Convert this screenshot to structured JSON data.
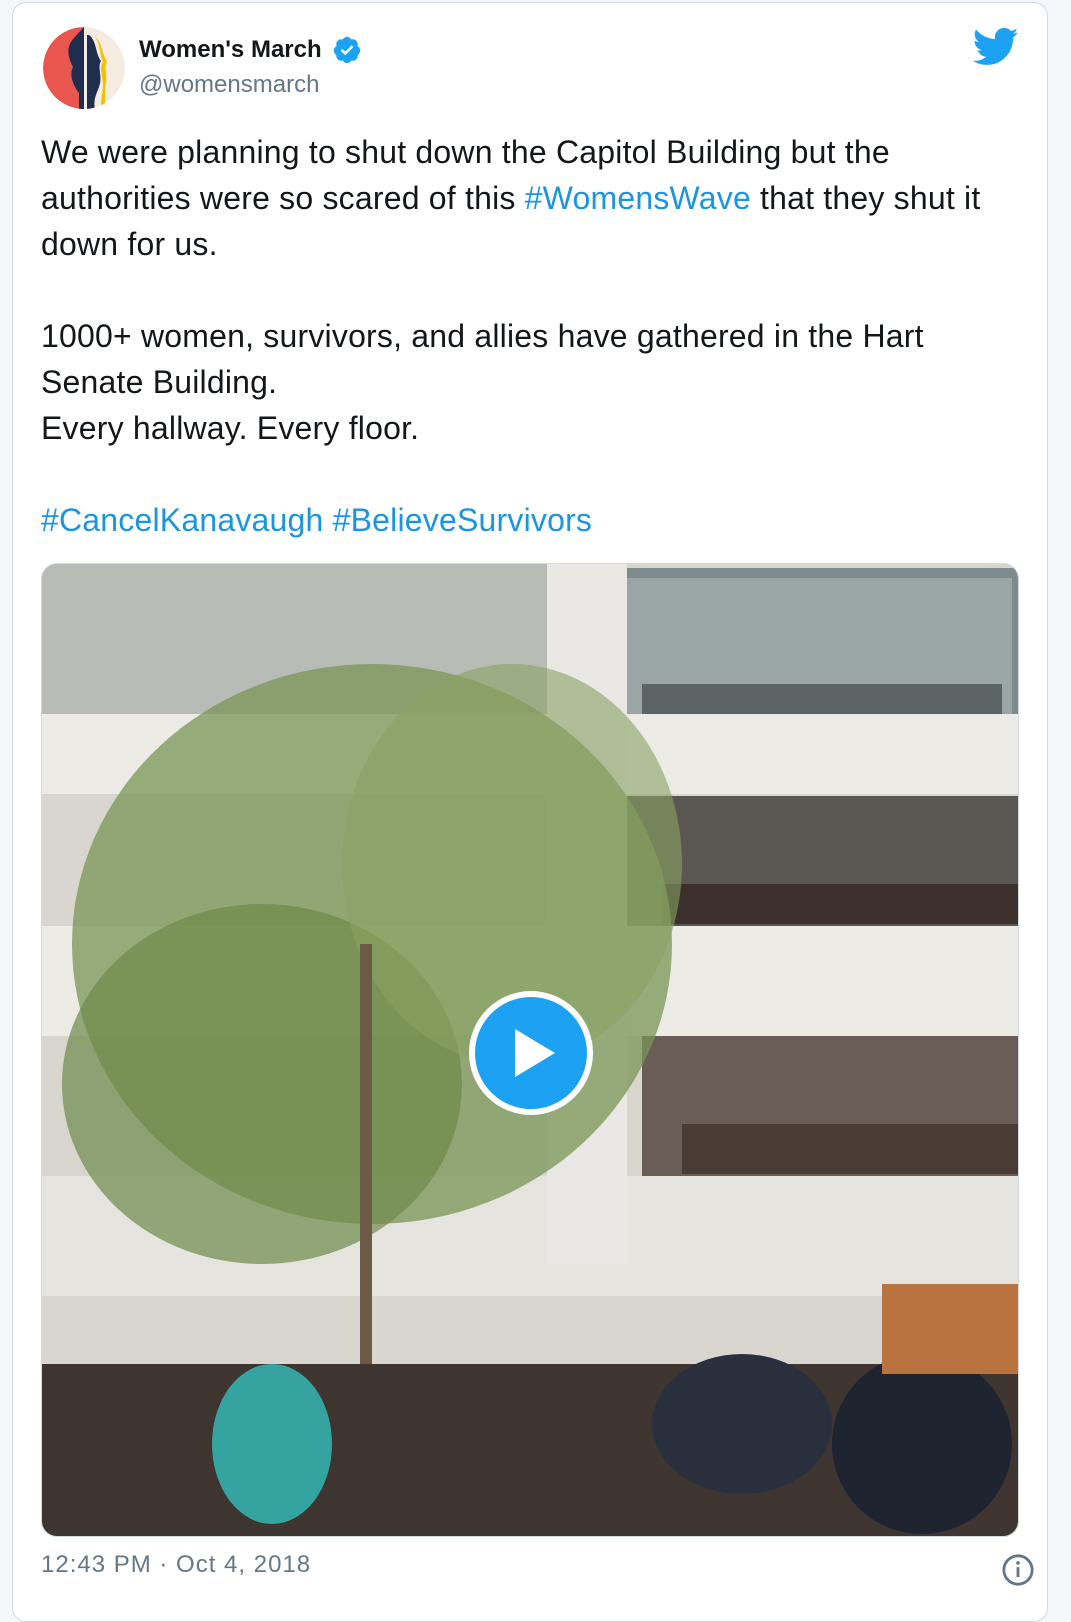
{
  "tweet": {
    "display_name": "Women's March",
    "handle": "@womensmarch",
    "verified": true,
    "paragraph1_pre": "We were planning to shut down the Capitol Building but the authorities were so scared of this ",
    "paragraph1_tag": "#WomensWave",
    "paragraph1_post": " that they shut it down for us.",
    "paragraph2_line1": "1000+ women, survivors, and allies have gathered in the Hart Senate Building.",
    "paragraph2_line2": "Every hallway. Every floor.",
    "hashtag1": "#CancelKanavaugh",
    "hashtag2": "#BelieveSurvivors",
    "timestamp": "12:43 PM · Oct 4, 2018"
  },
  "media": {
    "type": "video",
    "play_icon": "play-icon"
  },
  "icons": {
    "brand": "twitter-bird-icon",
    "verified": "verified-badge-icon",
    "info": "info-icon"
  },
  "colors": {
    "accent": "#1da1f2",
    "link": "#1b95e0",
    "text": "#14171a",
    "secondary": "#657786"
  }
}
